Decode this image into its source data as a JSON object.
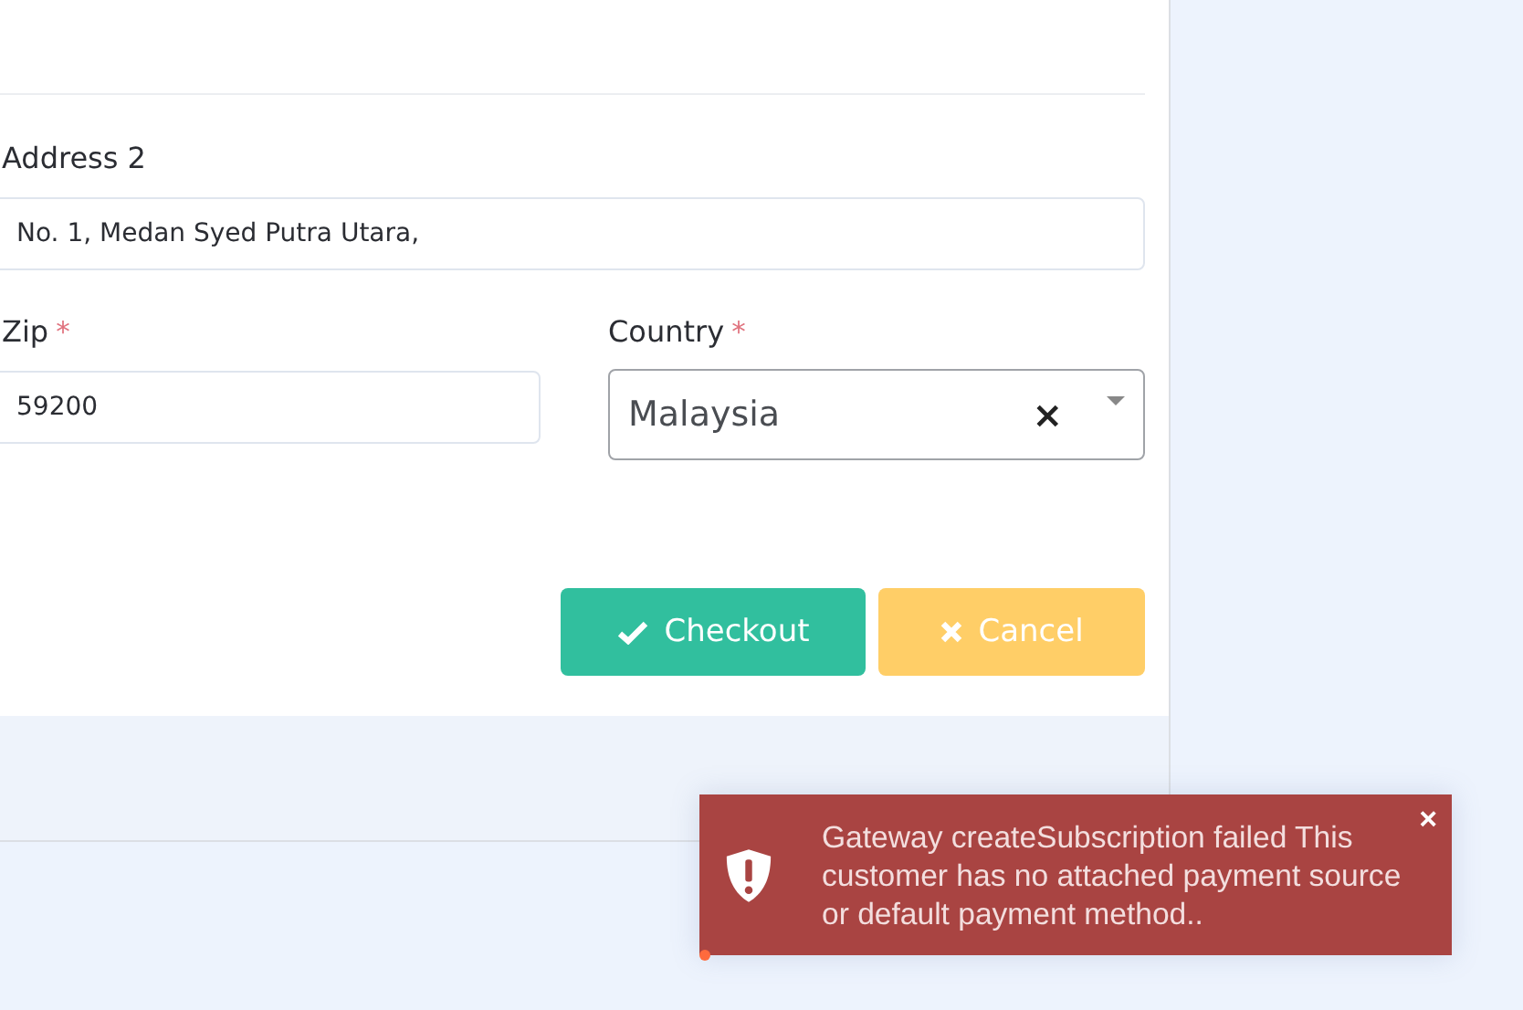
{
  "form": {
    "address2": {
      "label": "Address 2",
      "value": "No. 1, Medan Syed Putra Utara,"
    },
    "zip": {
      "label": "Zip",
      "required_mark": "*",
      "value": "59200"
    },
    "country": {
      "label": "Country",
      "required_mark": "*",
      "value": "Malaysia",
      "clear": "×"
    },
    "buttons": [
      {
        "label": "Checkout",
        "kind": "primary"
      },
      {
        "label": "Cancel",
        "kind": "warning"
      }
    ]
  },
  "toast": {
    "message": "Gateway createSubscription failed This customer has no attached payment source or default payment method..",
    "close": "×"
  }
}
